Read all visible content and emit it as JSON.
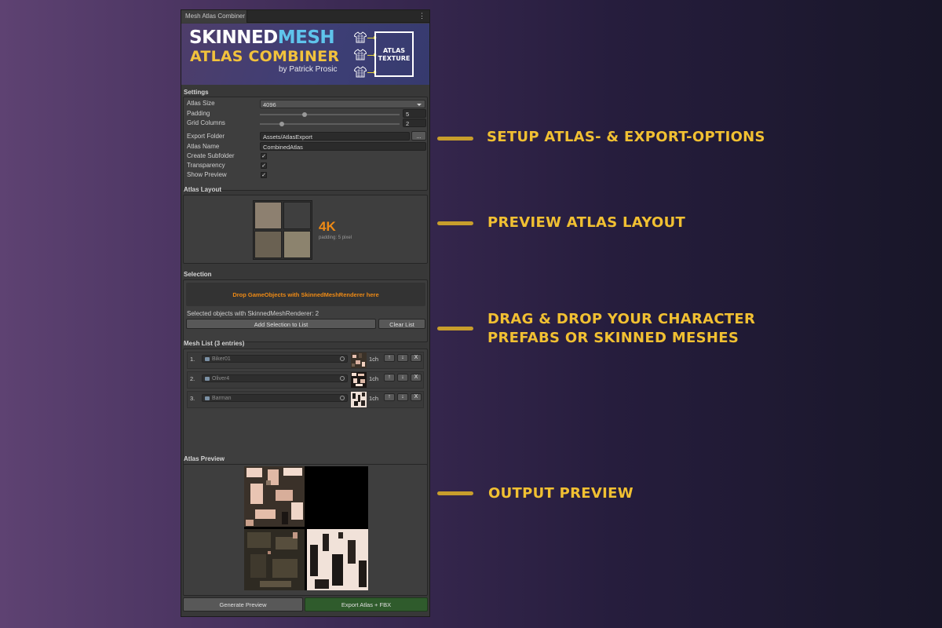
{
  "window": {
    "tab_title": "Mesh Atlas Combiner",
    "menu_glyph": "⋮"
  },
  "banner": {
    "line1_a": "SKINNED",
    "line1_b": "MESH",
    "line2": "ATLAS COMBINER",
    "byline": "by Patrick Prosic",
    "atlas_line1": "ATLAS",
    "atlas_line2": "TEXTURE",
    "colors": {
      "cyan": "#5fc4ec",
      "gold": "#f2c23c"
    }
  },
  "settings": {
    "title": "Settings",
    "atlas_size_label": "Atlas Size",
    "atlas_size_value": "4096",
    "padding_label": "Padding",
    "padding_value": "5",
    "grid_columns_label": "Grid Columns",
    "grid_columns_value": "2",
    "export_folder_label": "Export Folder",
    "export_folder_value": "Assets/AtlasExport",
    "browse_label": "...",
    "atlas_name_label": "Atlas Name",
    "atlas_name_value": "CombinedAtlas",
    "create_subfolder_label": "Create Subfolder",
    "transparency_label": "Transparency",
    "show_preview_label": "Show Preview",
    "check_glyph": "✓"
  },
  "atlas_layout": {
    "title": "Atlas Layout",
    "size_badge": "4K",
    "padding_text": "padding: 5 pixel"
  },
  "selection": {
    "title": "Selection",
    "drop_hint": "Drop GameObjects with SkinnedMeshRenderer here",
    "selected_text": "Selected objects with SkinnedMeshRenderer: 2",
    "add_button": "Add Selection to List",
    "clear_button": "Clear List"
  },
  "mesh_list": {
    "title": "Mesh List (3 entries)",
    "items": [
      {
        "num": "1.",
        "name": "Biker01",
        "ch": "1ch"
      },
      {
        "num": "2.",
        "name": "Oliver4",
        "ch": "1ch"
      },
      {
        "num": "3.",
        "name": "Barman",
        "ch": "1ch"
      }
    ],
    "up_glyph": "↑",
    "down_glyph": "↓",
    "remove_glyph": "X"
  },
  "atlas_preview": {
    "title": "Atlas Preview"
  },
  "footer": {
    "generate_button": "Generate Preview",
    "export_button": "Export Atlas + FBX"
  },
  "callouts": {
    "setup": "SETUP ATLAS- & EXPORT-OPTIONS",
    "preview_layout": "PREVIEW ATLAS LAYOUT",
    "drag_line1": "DRAG & DROP YOUR CHARACTER",
    "drag_line2": "PREFABS OR SKINNED MESHES",
    "output": "OUTPUT PREVIEW",
    "color": "#f1c032"
  }
}
